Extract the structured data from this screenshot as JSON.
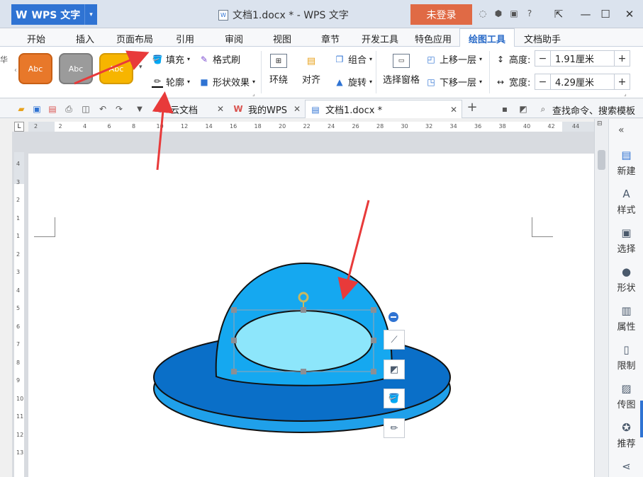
{
  "app": {
    "name": "WPS 文字",
    "logo": "W",
    "doc_title": "文档1.docx * - WPS 文字",
    "login_label": "未登录"
  },
  "window_controls": {
    "minimize": "—",
    "maximize": "☐",
    "close": "✕"
  },
  "menu_tabs": [
    "开始",
    "插入",
    "页面布局",
    "引用",
    "审阅",
    "视图",
    "章节",
    "开发工具",
    "特色应用",
    "绘图工具",
    "文档助手"
  ],
  "active_tab": "绘图工具",
  "ribbon": {
    "style_swatches": [
      {
        "label": "Abc",
        "color": "#e8782a"
      },
      {
        "label": "Abc",
        "color": "#9b9b9b"
      },
      {
        "label": "Abc",
        "color": "#f7b500"
      }
    ],
    "fill_label": "填充",
    "format_brush_label": "格式刷",
    "outline_label": "轮廓",
    "shape_effect_label": "形状效果",
    "wrap_label": "环绕",
    "align_label": "对齐",
    "group_label": "组合",
    "rotate_label": "旋转",
    "selection_pane_label": "选择窗格",
    "bring_forward_label": "上移一层",
    "send_backward_label": "下移一层",
    "height_label": "高度:",
    "height_value": "1.91厘米",
    "width_label": "宽度:",
    "width_value": "4.29厘米"
  },
  "quickbar": {
    "doc_tabs": [
      {
        "label": "云文档"
      },
      {
        "label": "我的WPS"
      },
      {
        "label": "文档1.docx *"
      }
    ],
    "search_label": "查找命令、搜索模板"
  },
  "ruler_h_labels": [
    "2",
    "2",
    "4",
    "6",
    "8",
    "10",
    "12",
    "14",
    "16",
    "18",
    "20",
    "22",
    "24",
    "26",
    "28",
    "30",
    "32",
    "34",
    "36",
    "38",
    "40",
    "42",
    "44"
  ],
  "ruler_v_labels": [
    "4",
    "3",
    "2",
    "1",
    "1",
    "2",
    "3",
    "4",
    "5",
    "6",
    "7",
    "8",
    "9",
    "10",
    "11",
    "12",
    "13"
  ],
  "side_panel": [
    "新建",
    "样式",
    "选择",
    "形状",
    "属性",
    "限制",
    "传图",
    "推荐"
  ],
  "partial_left_char": "华",
  "colors": {
    "hat_brim_top": "#0a6fc8",
    "hat_brim_side": "#1fa0ea",
    "hat_dome": "#15a8f0",
    "hat_ellipse": "#8de6fb",
    "accent": "#2f73d3",
    "login": "#e06a45",
    "arrow": "#e83a3a"
  }
}
